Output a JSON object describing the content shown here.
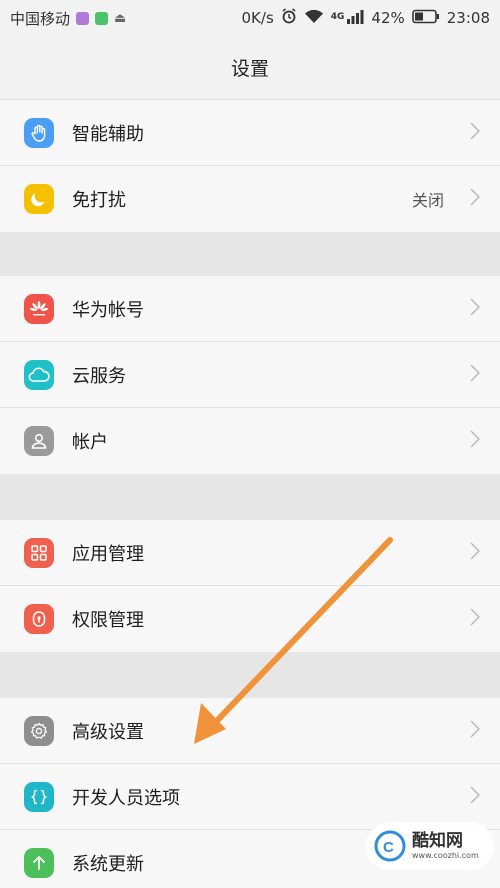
{
  "status_bar": {
    "carrier": "中国移动",
    "speed": "0K/s",
    "network": "4G",
    "battery": "42%",
    "time": "23:08"
  },
  "title": "设置",
  "groups": [
    {
      "items": [
        {
          "label": "智能辅助",
          "icon": "hand-icon",
          "color": "#4a9ff5"
        },
        {
          "label": "免打扰",
          "icon": "moon-icon",
          "color": "#f5c000",
          "value": "关闭"
        }
      ]
    },
    {
      "items": [
        {
          "label": "华为帐号",
          "icon": "huawei-icon",
          "color": "#f0534a"
        },
        {
          "label": "云服务",
          "icon": "cloud-icon",
          "color": "#1fc0c8"
        },
        {
          "label": "帐户",
          "icon": "user-icon",
          "color": "#9a9a9a"
        }
      ]
    },
    {
      "items": [
        {
          "label": "应用管理",
          "icon": "apps-grid-icon",
          "color": "#f0604f"
        },
        {
          "label": "权限管理",
          "icon": "permission-lock-icon",
          "color": "#f0604f"
        }
      ]
    },
    {
      "items": [
        {
          "label": "高级设置",
          "icon": "gear-icon",
          "color": "#8e8e8e"
        },
        {
          "label": "开发人员选项",
          "icon": "braces-icon",
          "color": "#1fb6c8"
        },
        {
          "label": "系统更新",
          "icon": "update-arrow-icon",
          "color": "#4cbf5a"
        }
      ]
    }
  ],
  "watermark": {
    "name": "酷知网",
    "url": "www.coozhi.com"
  }
}
